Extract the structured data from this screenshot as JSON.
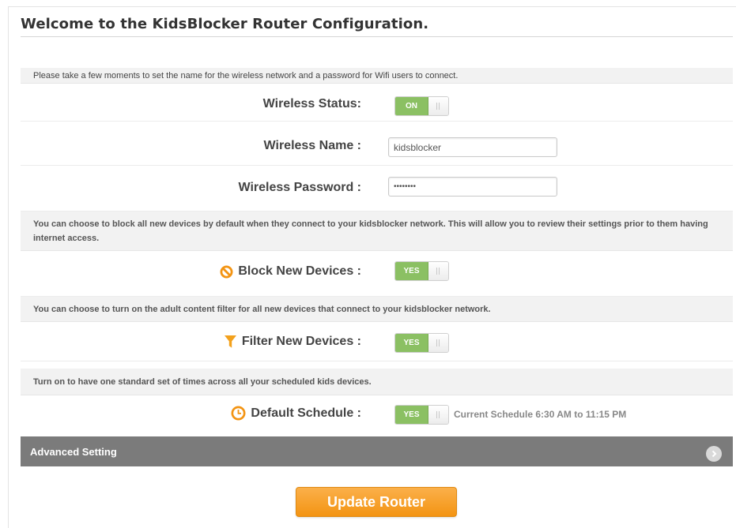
{
  "page": {
    "title": "Welcome to the KidsBlocker Router Configuration."
  },
  "bands": {
    "intro": "Please take a few moments to set the name for the wireless network and a password for Wifi users to connect.",
    "block_info": "You can choose to block all new devices by default when they connect to your kidsblocker network. This will allow you to review their settings prior to them having internet access.",
    "filter_info": "You can choose to turn on the adult content filter for all new devices that connect to your kidsblocker network.",
    "schedule_info": "Turn on to have one standard set of times across all your scheduled kids devices."
  },
  "wireless": {
    "status_label": "Wireless Status:",
    "status_value": "ON",
    "name_label": "Wireless Name :",
    "name_value": "kidsblocker",
    "password_label": "Wireless Password :",
    "password_value": "password"
  },
  "devices": {
    "block_label": "Block New Devices :",
    "block_value": "YES",
    "filter_label": "Filter New Devices :",
    "filter_value": "YES"
  },
  "schedule": {
    "label": "Default Schedule :",
    "value": "YES",
    "current": "Current Schedule 6:30 AM to 11:15 PM"
  },
  "advanced": {
    "label": "Advanced Setting"
  },
  "actions": {
    "update_label": "Update Router"
  },
  "colors": {
    "toggle_on": "#8bc063",
    "accent_orange": "#f39413",
    "advanced_bar": "#7b7b7b"
  },
  "icons": {
    "block": "prohibited-icon",
    "filter": "funnel-icon",
    "schedule": "clock-icon",
    "advanced": "chevron-right-icon"
  }
}
